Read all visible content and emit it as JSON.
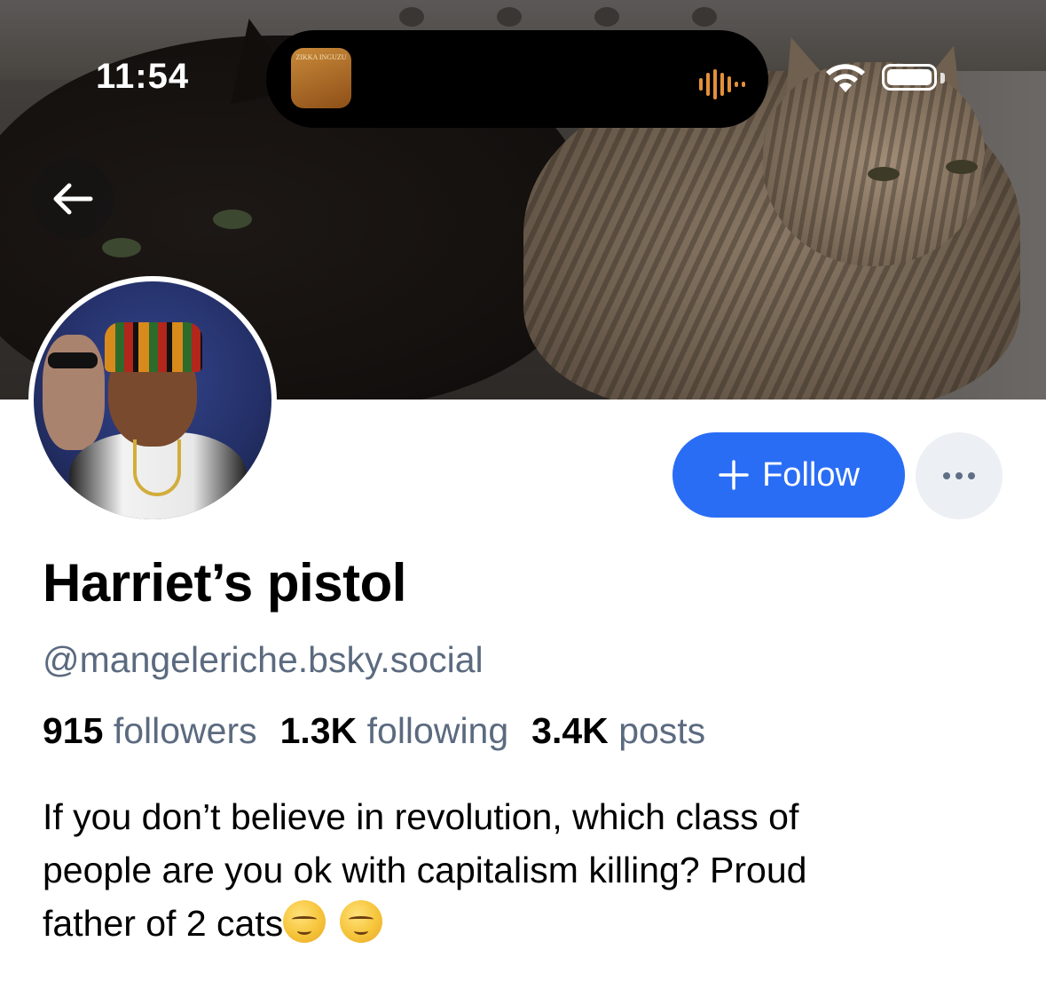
{
  "status_bar": {
    "time": "11:54",
    "now_playing_album_text": "ZIKKA INGUZU",
    "wifi_icon": "wifi-icon",
    "battery_icon": "battery-icon"
  },
  "header": {
    "back_icon": "arrow-left-icon"
  },
  "profile": {
    "display_name": "Harriet’s pistol",
    "handle": "@mangeleriche.bsky.social",
    "stats": {
      "followers_count": "915",
      "followers_label": "followers",
      "following_count": "1.3K",
      "following_label": "following",
      "posts_count": "3.4K",
      "posts_label": "posts"
    },
    "bio_line1": "If you don’t believe in revolution, which class of",
    "bio_line2": "people are you ok with capitalism killing? Proud",
    "bio_line3": "father of 2 cats"
  },
  "actions": {
    "follow_label": "Follow",
    "follow_icon": "plus-icon",
    "more_icon": "ellipsis-icon"
  },
  "colors": {
    "accent": "#2a6df5",
    "muted_text": "#5b6a7f",
    "more_button_bg": "#ecf0f5"
  }
}
